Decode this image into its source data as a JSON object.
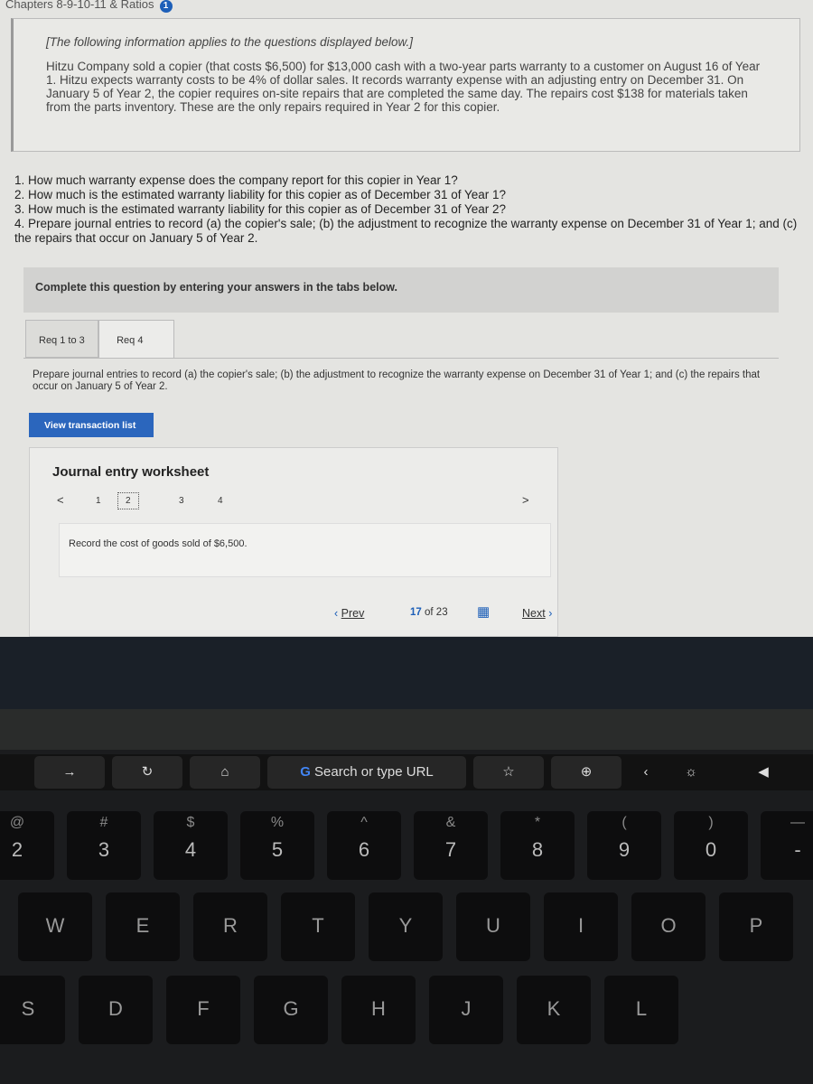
{
  "header": {
    "breadcrumb": "Chapters 8-9-10-11 & Ratios",
    "badge": "1"
  },
  "info": {
    "intro": "[The following information applies to the questions displayed below.]",
    "body": "Hitzu Company sold a copier (that costs $6,500) for $13,000 cash with a two-year parts warranty to a customer on August 16 of Year 1. Hitzu expects warranty costs to be 4% of dollar sales. It records warranty expense with an adjusting entry on December 31. On January 5 of Year 2, the copier requires on-site repairs that are completed the same day. The repairs cost $138 for materials taken from the parts inventory. These are the only repairs required in Year 2 for this copier."
  },
  "questions": [
    "1. How much warranty expense does the company report for this copier in Year 1?",
    "2. How much is the estimated warranty liability for this copier as of December 31 of Year 1?",
    "3. How much is the estimated warranty liability for this copier as of December 31 of Year 2?",
    "4. Prepare journal entries to record (a) the copier's sale; (b) the adjustment to recognize the warranty expense on December 31 of Year 1; and (c) the repairs that occur on January 5 of Year 2."
  ],
  "complete_text": "Complete this question by entering your answers in the tabs below.",
  "tabs": [
    {
      "label": "Req 1 to 3"
    },
    {
      "label": "Req 4",
      "active": true
    }
  ],
  "prompt": "Prepare journal entries to record (a) the copier's sale; (b) the adjustment to recognize the warranty expense on December 31 of Year 1; and (c) the repairs that occur on January 5 of Year 2.",
  "view_button": "View transaction list",
  "worksheet": {
    "title": "Journal entry worksheet",
    "prev": "<",
    "next": ">",
    "pages": [
      "1",
      "2",
      "3",
      "4"
    ],
    "selected_page": "2",
    "record": "Record the cost of goods sold of $6,500."
  },
  "navigation": {
    "prev": "Prev",
    "current": "17",
    "of": "of",
    "total": "23",
    "next": "Next"
  },
  "touchbar": {
    "url_placeholder": "Search or type URL",
    "google": "G"
  },
  "keyboard": {
    "row1": [
      {
        "top": "@",
        "bottom": "2"
      },
      {
        "top": "#",
        "bottom": "3"
      },
      {
        "top": "$",
        "bottom": "4"
      },
      {
        "top": "%",
        "bottom": "5"
      },
      {
        "top": "^",
        "bottom": "6"
      },
      {
        "top": "&",
        "bottom": "7"
      },
      {
        "top": "*",
        "bottom": "8"
      },
      {
        "top": "(",
        "bottom": "9"
      },
      {
        "top": ")",
        "bottom": "0"
      },
      {
        "top": "—",
        "bottom": "-"
      }
    ],
    "row2": [
      "W",
      "E",
      "R",
      "T",
      "Y",
      "U",
      "I",
      "O",
      "P"
    ],
    "row3": [
      "S",
      "D",
      "F",
      "G",
      "H",
      "J",
      "K",
      "L"
    ]
  },
  "colors": {
    "accent": "#2b66bd",
    "screen": "#e4e4e1"
  }
}
